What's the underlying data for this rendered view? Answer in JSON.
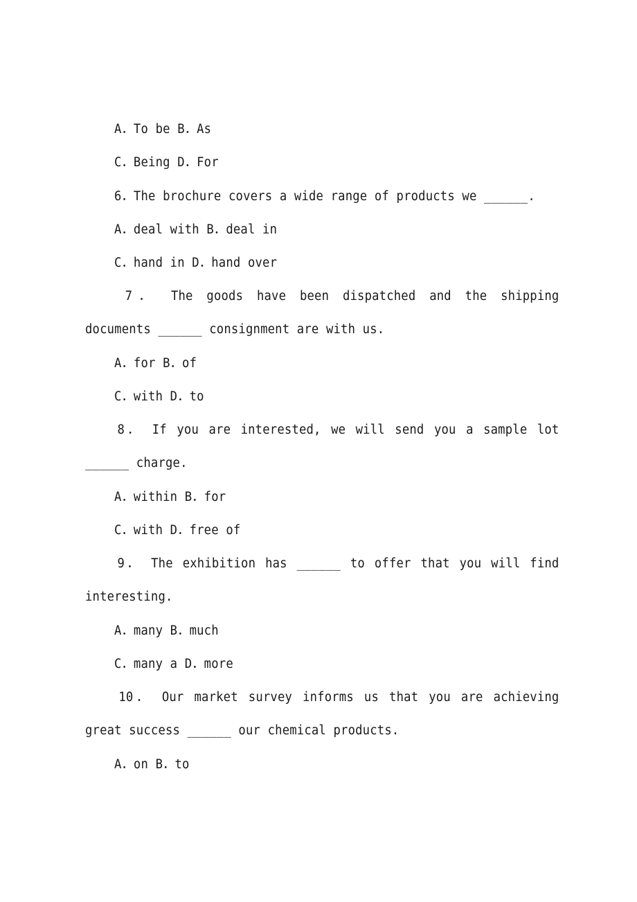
{
  "document": {
    "lines": [
      {
        "id": "q5-ab",
        "text": "A．To be B．As"
      },
      {
        "id": "q5-cd",
        "text": "C．Being D．For"
      },
      {
        "id": "q6-stem",
        "text": "6．The brochure covers a wide range of products we ______."
      },
      {
        "id": "q6-ab",
        "text": "A．deal with B．deal in"
      },
      {
        "id": "q6-cd",
        "text": "C．hand in D．hand over"
      },
      {
        "id": "q7-stem-1",
        "text": "7． The goods have been dispatched and the shipping"
      },
      {
        "id": "q7-stem-2",
        "text": "documents ______ consignment are with us."
      },
      {
        "id": "q7-ab",
        "text": "A．for B．of"
      },
      {
        "id": "q7-cd",
        "text": "C．with D．to"
      },
      {
        "id": "q8-stem-1",
        "text": "8． If you are interested, we will send you a sample lot"
      },
      {
        "id": "q8-stem-2",
        "text": "______ charge."
      },
      {
        "id": "q8-ab",
        "text": "A．within B．for"
      },
      {
        "id": "q8-cd",
        "text": "C．with D．free of"
      },
      {
        "id": "q9-stem-1",
        "text": "9． The exhibition has ______ to offer that you will find"
      },
      {
        "id": "q9-stem-2",
        "text": "interesting."
      },
      {
        "id": "q9-ab",
        "text": "A．many B．much"
      },
      {
        "id": "q9-cd",
        "text": "C．many a D．more"
      },
      {
        "id": "q10-stem-1",
        "text": "10． Our market survey informs us that you are achieving"
      },
      {
        "id": "q10-stem-2",
        "text": "great success ______ our chemical products."
      },
      {
        "id": "q10-ab",
        "text": "A．on B．to"
      }
    ]
  }
}
